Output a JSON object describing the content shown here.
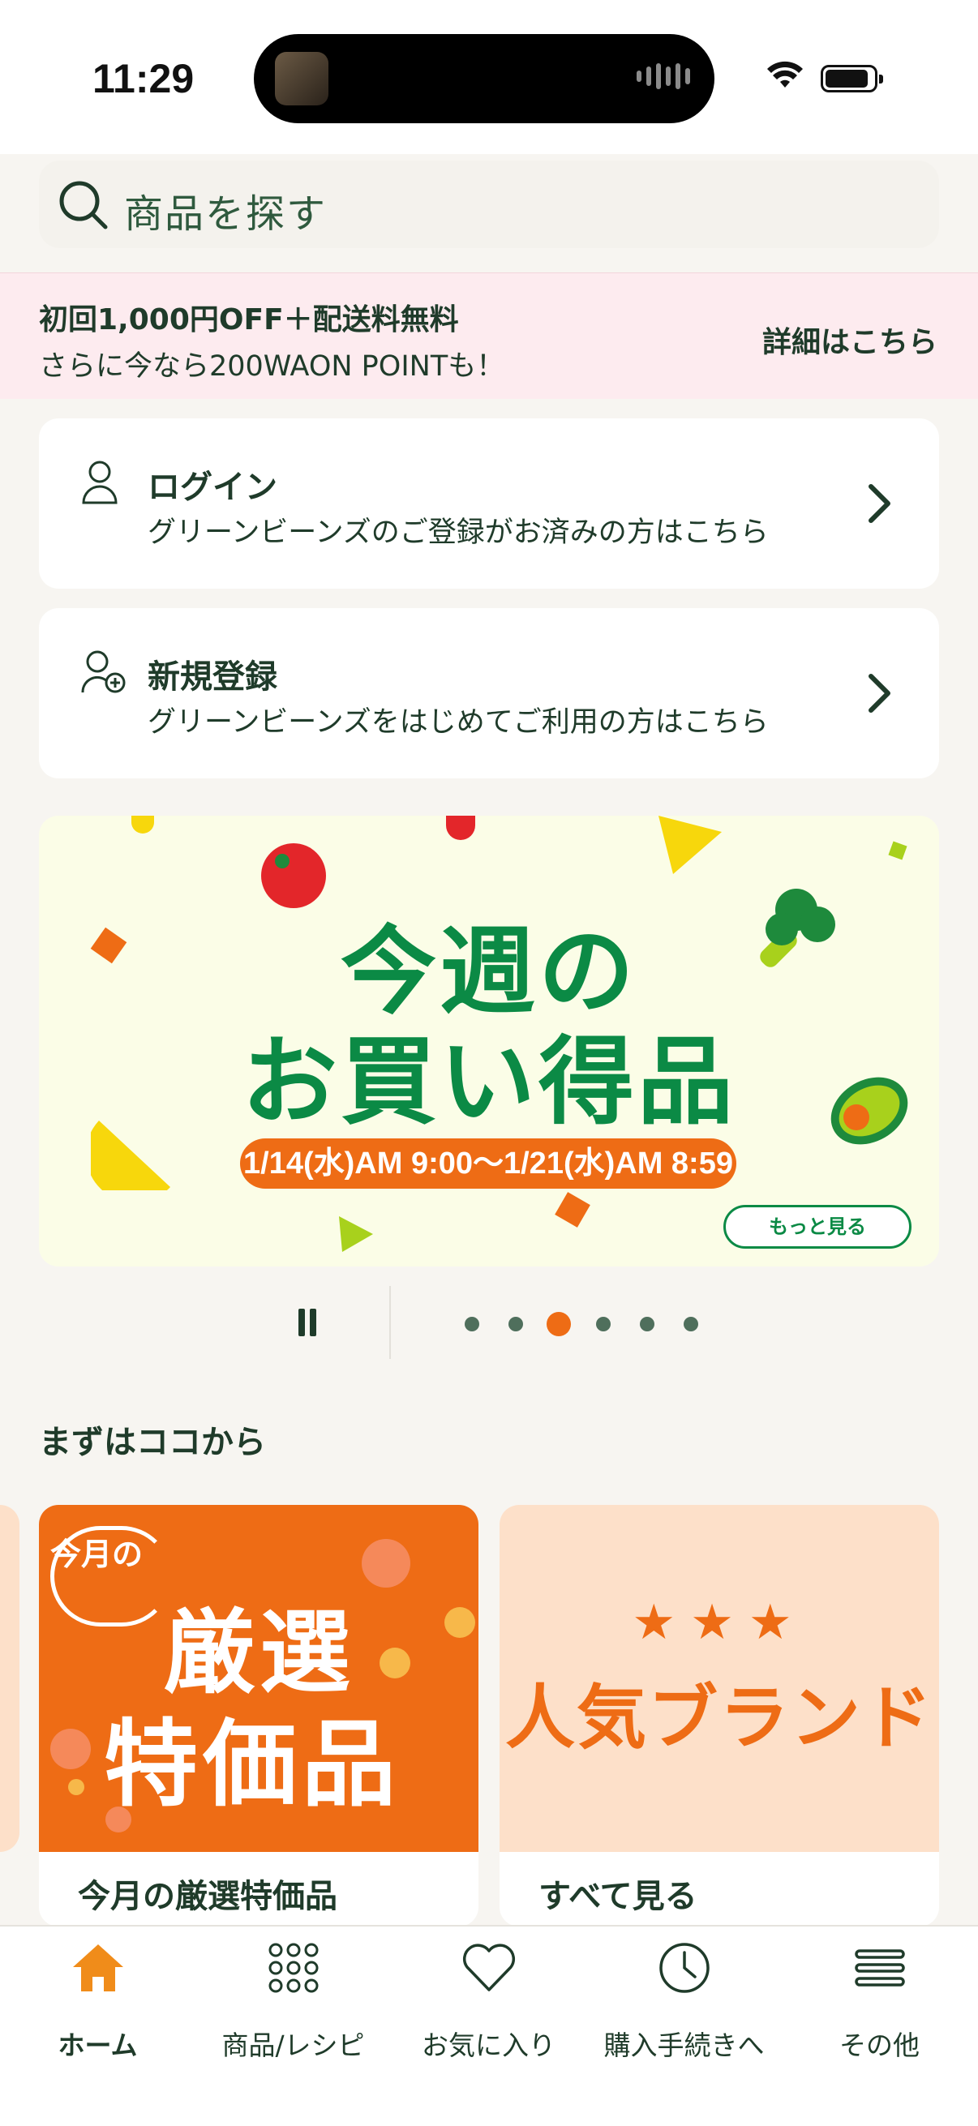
{
  "status_bar": {
    "time": "11:29"
  },
  "search": {
    "placeholder": "商品を探す"
  },
  "promo": {
    "line1": "初回1,000円OFF＋配送料無料",
    "line2": "さらに今なら200WAON POINTも！",
    "link": "詳細はこちら"
  },
  "login_card": {
    "title": "ログイン",
    "subtitle": "グリーンビーンズのご登録がお済みの方はこちら"
  },
  "register_card": {
    "title": "新規登録",
    "subtitle": "グリーンビーンズをはじめてご利用の方はこちら"
  },
  "banner": {
    "title_line1": "今週の",
    "title_line2": "お買い得品",
    "date_range": "1/14(水)AM 9:00〜1/21(水)AM 8:59",
    "more_button": "もっと見る",
    "carousel_active_index": 2,
    "carousel_count": 6
  },
  "section": {
    "title": "まずはココから"
  },
  "tiles": [
    {
      "badge": "今月の",
      "art_line1": "厳選",
      "art_line2": "特価品",
      "label": "今月の厳選特価品"
    },
    {
      "art_text": "人気ブランド",
      "label": "すべて見る"
    }
  ],
  "tabbar": {
    "items": [
      {
        "label": "ホーム",
        "icon": "home-icon",
        "active": true
      },
      {
        "label": "商品/レシピ",
        "icon": "grid-icon",
        "active": false
      },
      {
        "label": "お気に入り",
        "icon": "heart-icon",
        "active": false
      },
      {
        "label": "購入手続きへ",
        "icon": "clock-icon",
        "active": false
      },
      {
        "label": "その他",
        "icon": "menu-icon",
        "active": false
      }
    ]
  },
  "colors": {
    "accent_orange": "#ee6c15",
    "brand_green": "#0b8a45",
    "text_dark": "#1f3b2a",
    "promo_bg": "#fdebef"
  }
}
